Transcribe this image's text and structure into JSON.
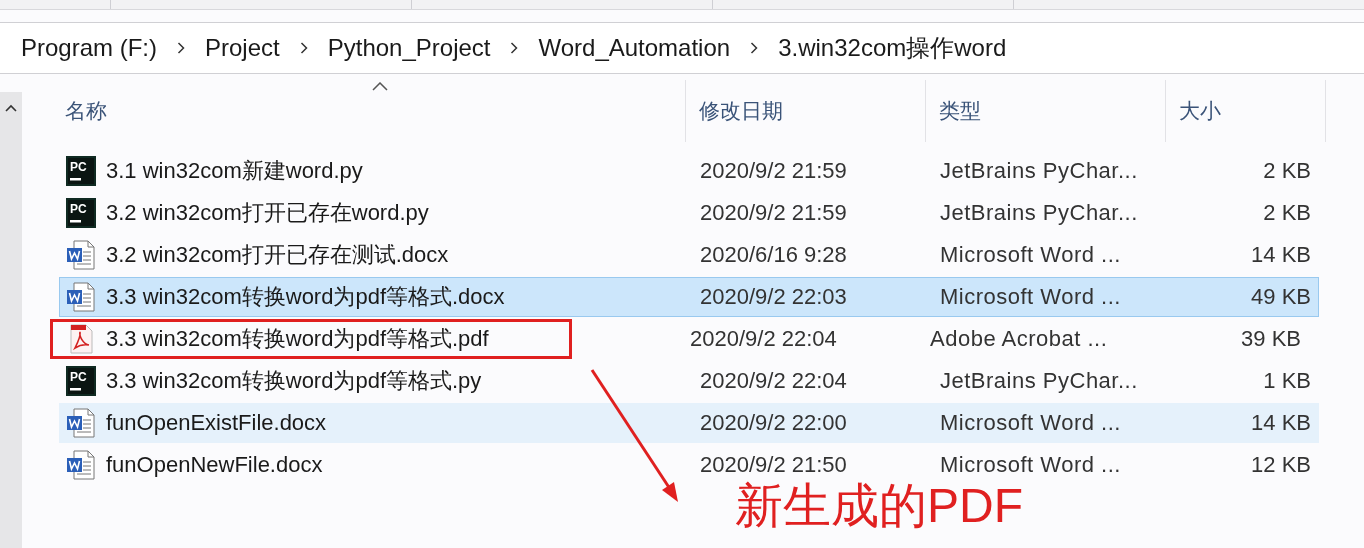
{
  "breadcrumb": [
    "Program (F:)",
    "Project",
    "Python_Project",
    "Word_Automation",
    "3.win32com操作word"
  ],
  "columns": [
    {
      "label": "名称",
      "sorted": true
    },
    {
      "label": "修改日期",
      "sorted": false
    },
    {
      "label": "类型",
      "sorted": false
    },
    {
      "label": "大小",
      "sorted": false
    }
  ],
  "files": [
    {
      "kind": "pycharm",
      "badge": "PC",
      "name": "3.1 win32com新建word.py",
      "modified": "2020/9/2 21:59",
      "type": "JetBrains PyChar...",
      "size": "2 KB",
      "selected": false,
      "hovered": false,
      "outlined": false
    },
    {
      "kind": "pycharm",
      "badge": "PC",
      "name": "3.2 win32com打开已存在word.py",
      "modified": "2020/9/2 21:59",
      "type": "JetBrains PyChar...",
      "size": "2 KB",
      "selected": false,
      "hovered": false,
      "outlined": false
    },
    {
      "kind": "word",
      "name": "3.2 win32com打开已存在测试.docx",
      "modified": "2020/6/16 9:28",
      "type": "Microsoft Word ...",
      "size": "14 KB",
      "selected": false,
      "hovered": false,
      "outlined": false
    },
    {
      "kind": "word",
      "name": "3.3 win32com转换word为pdf等格式.docx",
      "modified": "2020/9/2 22:03",
      "type": "Microsoft Word ...",
      "size": "49 KB",
      "selected": true,
      "hovered": false,
      "outlined": false
    },
    {
      "kind": "pdf",
      "name": "3.3 win32com转换word为pdf等格式.pdf",
      "modified": "2020/9/2 22:04",
      "type": "Adobe Acrobat ...",
      "size": "39 KB",
      "selected": false,
      "hovered": false,
      "outlined": true
    },
    {
      "kind": "pycharm",
      "badge": "PC",
      "name": "3.3 win32com转换word为pdf等格式.py",
      "modified": "2020/9/2 22:04",
      "type": "JetBrains PyChar...",
      "size": "1 KB",
      "selected": false,
      "hovered": false,
      "outlined": false
    },
    {
      "kind": "word",
      "name": "funOpenExistFile.docx",
      "modified": "2020/9/2 22:00",
      "type": "Microsoft Word ...",
      "size": "14 KB",
      "selected": false,
      "hovered": true,
      "outlined": false
    },
    {
      "kind": "word",
      "name": "funOpenNewFile.docx",
      "modified": "2020/9/2 21:50",
      "type": "Microsoft Word ...",
      "size": "12 KB",
      "selected": false,
      "hovered": false,
      "outlined": false
    }
  ],
  "annotation": {
    "text": "新生成的PDF"
  }
}
